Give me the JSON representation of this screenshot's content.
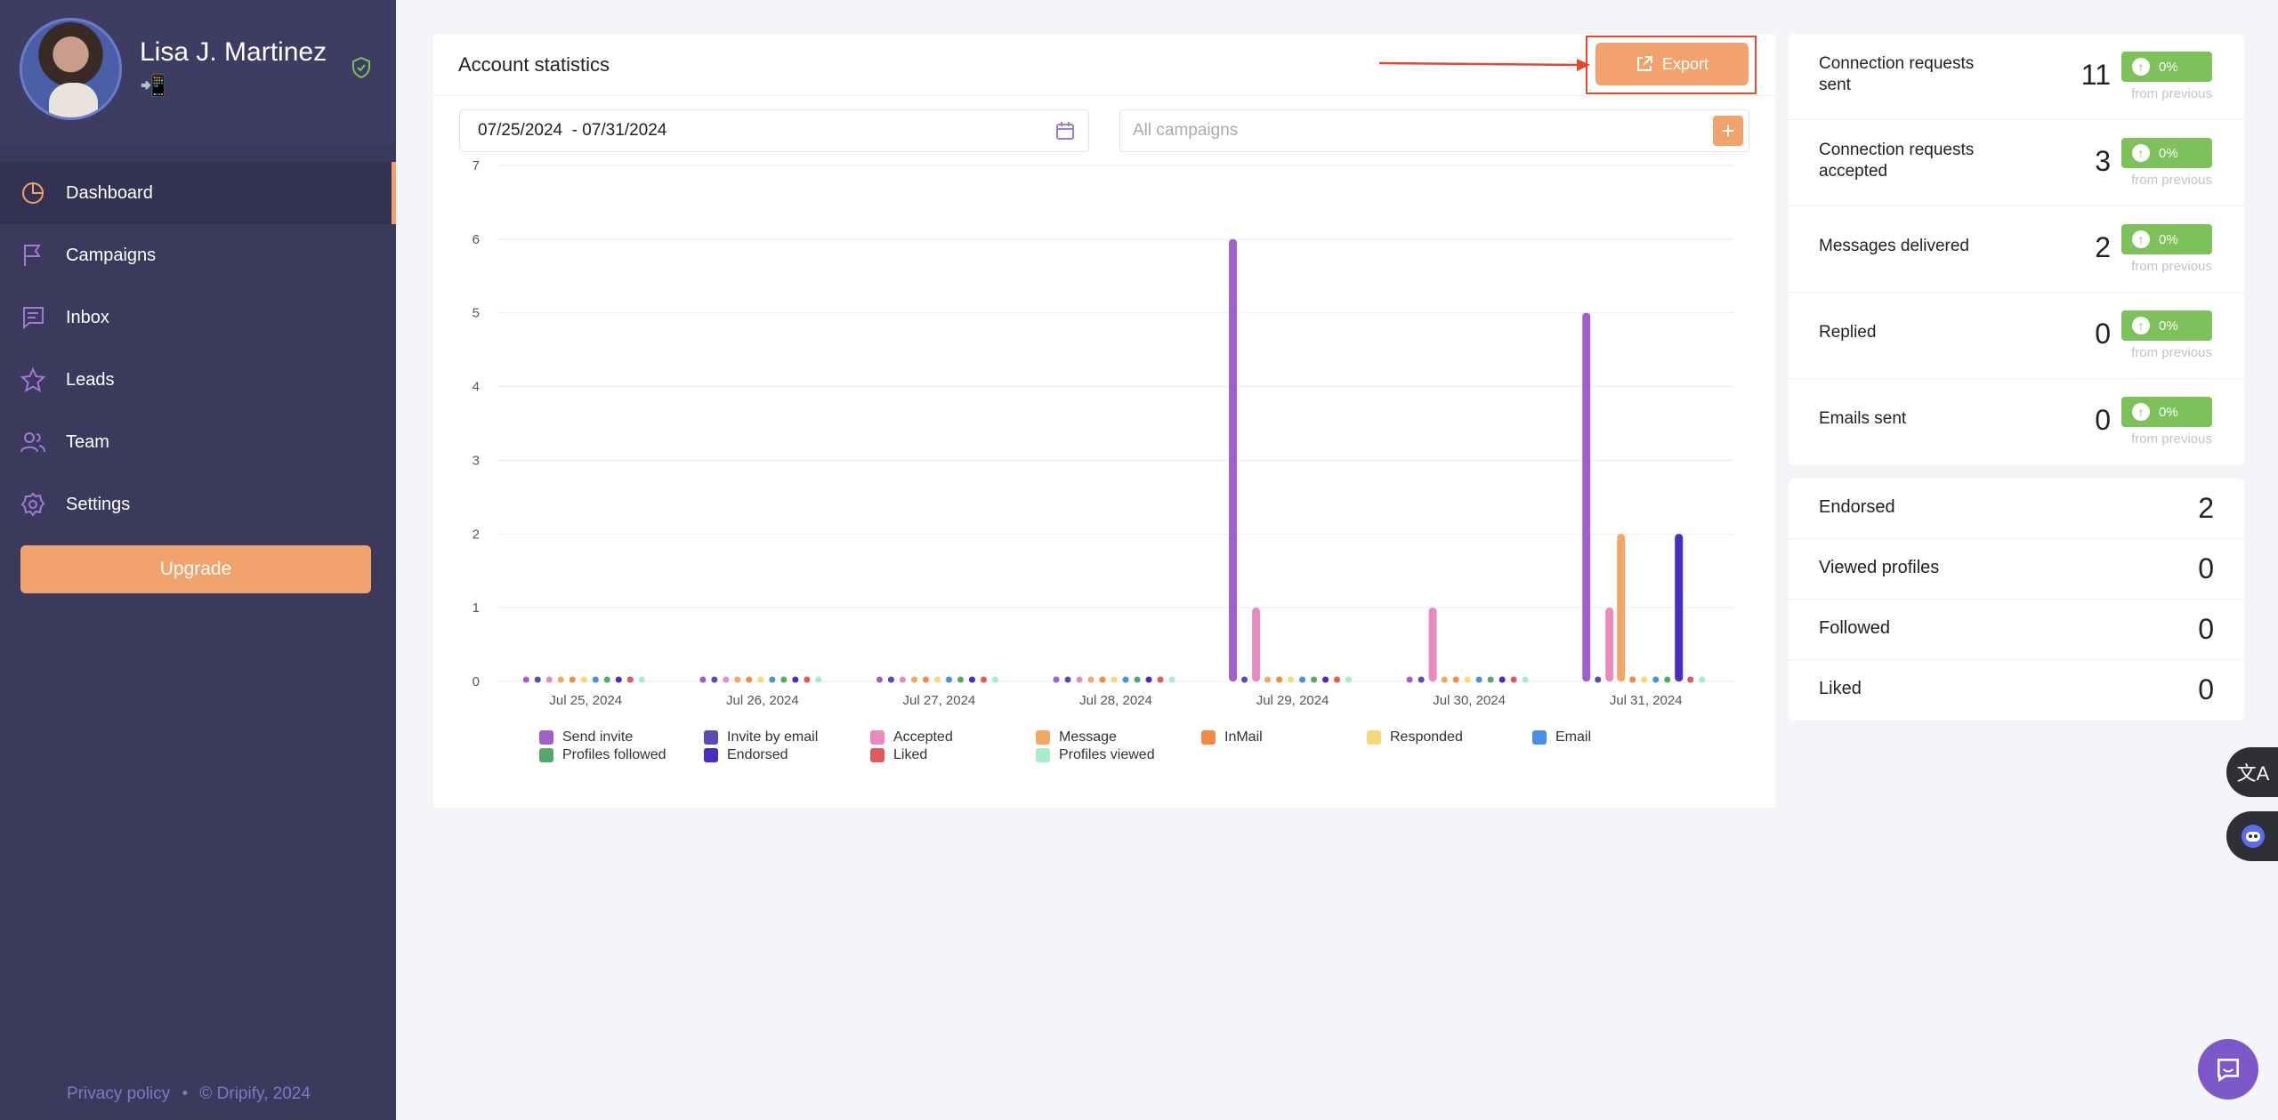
{
  "user": {
    "name": "Lisa J. Martinez",
    "status_emoji": "📲"
  },
  "nav": [
    {
      "label": "Dashboard",
      "icon": "pie-chart-icon",
      "active": true
    },
    {
      "label": "Campaigns",
      "icon": "flag-icon"
    },
    {
      "label": "Inbox",
      "icon": "chat-icon"
    },
    {
      "label": "Leads",
      "icon": "star-icon"
    },
    {
      "label": "Team",
      "icon": "users-icon"
    },
    {
      "label": "Settings",
      "icon": "gear-icon"
    }
  ],
  "upgrade_label": "Upgrade",
  "footer": {
    "privacy": "Privacy policy",
    "separator": "•",
    "copyright": "© Dripify, 2024"
  },
  "panel": {
    "title": "Account statistics",
    "export_label": "Export",
    "date_range": "07/25/2024  - 07/31/2024",
    "campaigns_placeholder": "All campaigns",
    "plus_label": "+"
  },
  "chart_data": {
    "type": "bar",
    "categories": [
      "Jul 25, 2024",
      "Jul 26, 2024",
      "Jul 27, 2024",
      "Jul 28, 2024",
      "Jul 29, 2024",
      "Jul 30, 2024",
      "Jul 31, 2024"
    ],
    "ylim": [
      0,
      7
    ],
    "yticks": [
      0,
      1,
      2,
      3,
      4,
      5,
      6,
      7
    ],
    "grid": true,
    "legend_position": "bottom",
    "series": [
      {
        "name": "Send invite",
        "color": "#a25fc9",
        "values": [
          0,
          0,
          0,
          0,
          6,
          0,
          5
        ]
      },
      {
        "name": "Invite by email",
        "color": "#5a4cb0",
        "values": [
          0,
          0,
          0,
          0,
          0,
          0,
          0
        ]
      },
      {
        "name": "Accepted",
        "color": "#e98abf",
        "values": [
          0,
          0,
          0,
          0,
          1,
          1,
          1
        ]
      },
      {
        "name": "Message",
        "color": "#f1a766",
        "values": [
          0,
          0,
          0,
          0,
          0,
          0,
          2
        ]
      },
      {
        "name": "InMail",
        "color": "#ef8b44",
        "values": [
          0,
          0,
          0,
          0,
          0,
          0,
          0
        ]
      },
      {
        "name": "Responded",
        "color": "#f6d77a",
        "values": [
          0,
          0,
          0,
          0,
          0,
          0,
          0
        ]
      },
      {
        "name": "Email",
        "color": "#4a90e2",
        "values": [
          0,
          0,
          0,
          0,
          0,
          0,
          0
        ]
      },
      {
        "name": "Profiles followed",
        "color": "#56a86a",
        "values": [
          0,
          0,
          0,
          0,
          0,
          0,
          0
        ]
      },
      {
        "name": "Endorsed",
        "color": "#4a2cc0",
        "values": [
          0,
          0,
          0,
          0,
          0,
          0,
          2
        ]
      },
      {
        "name": "Liked",
        "color": "#e05a5a",
        "values": [
          0,
          0,
          0,
          0,
          0,
          0,
          0
        ]
      },
      {
        "name": "Profiles viewed",
        "color": "#a8ecc8",
        "values": [
          0,
          0,
          0,
          0,
          0,
          0,
          0
        ]
      }
    ]
  },
  "stats": [
    {
      "label": "Connection requests sent",
      "value": "11",
      "badge": "0%",
      "sub": "from previous"
    },
    {
      "label": "Connection requests accepted",
      "value": "3",
      "badge": "0%",
      "sub": "from previous"
    },
    {
      "label": "Messages delivered",
      "value": "2",
      "badge": "0%",
      "sub": "from previous"
    },
    {
      "label": "Replied",
      "value": "0",
      "badge": "0%",
      "sub": "from previous"
    },
    {
      "label": "Emails sent",
      "value": "0",
      "badge": "0%",
      "sub": "from previous"
    }
  ],
  "counts": [
    {
      "label": "Endorsed",
      "value": "2"
    },
    {
      "label": "Viewed profiles",
      "value": "0"
    },
    {
      "label": "Followed",
      "value": "0"
    },
    {
      "label": "Liked",
      "value": "0"
    }
  ],
  "colors": {
    "sidebar": "#3c3a5c",
    "accent": "#f2a26c",
    "badge": "#7cc15a",
    "highlight": "#e24a2b"
  }
}
